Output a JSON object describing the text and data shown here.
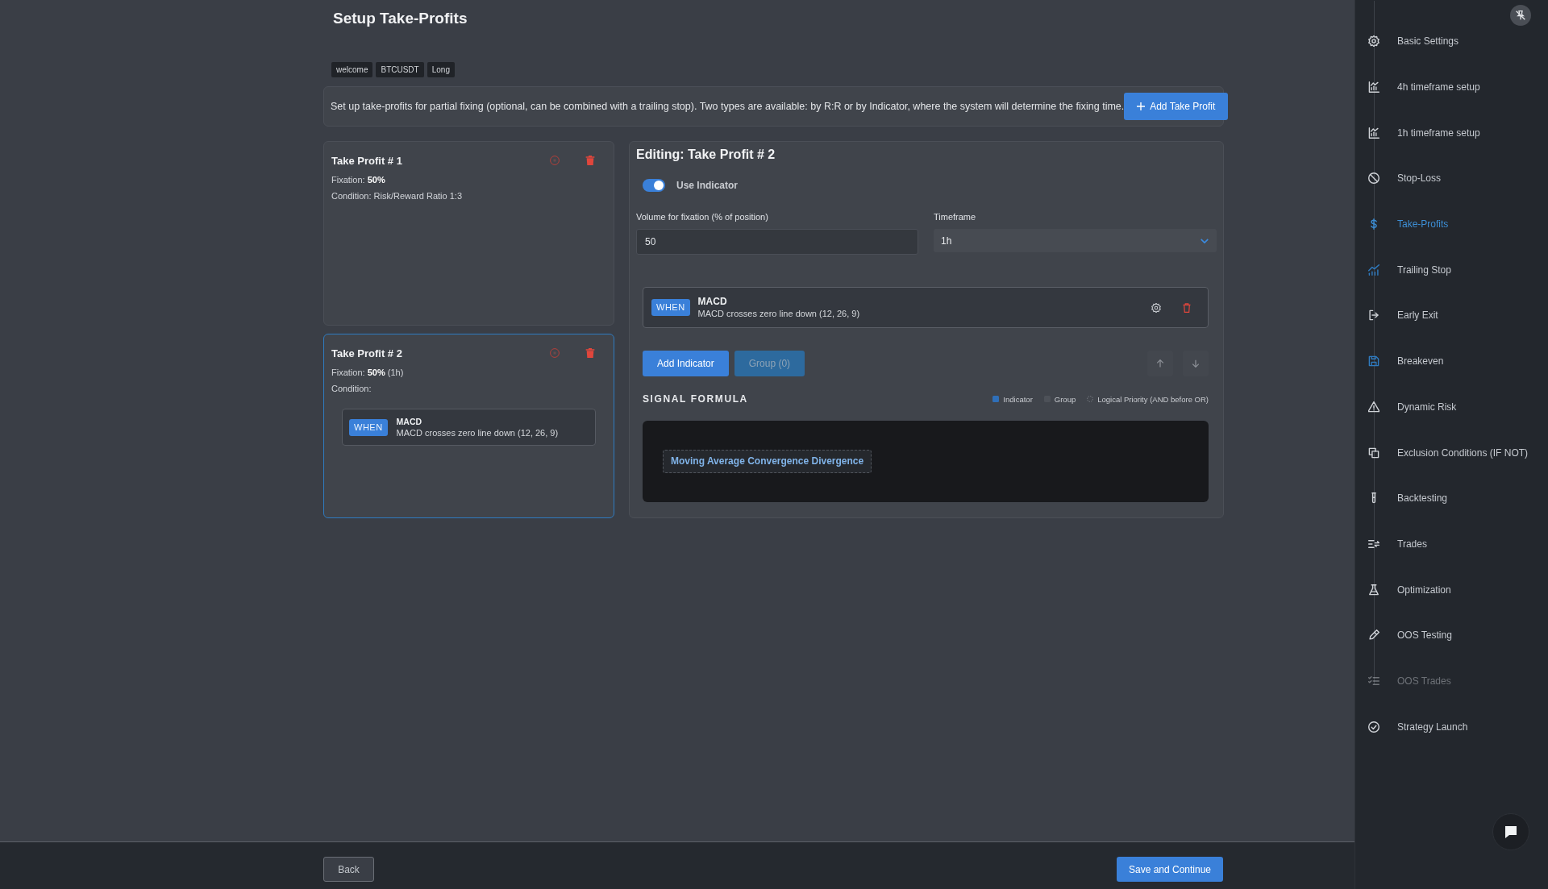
{
  "page": {
    "title": "Setup Take-Profits",
    "tags": [
      "welcome",
      "BTCUSDT",
      "Long"
    ]
  },
  "info_bar": {
    "text": "Set up take-profits for partial fixing (optional, can be combined with a trailing stop). Two types are available: by R:R or by Indicator, where the system will determine the fixing time.",
    "button": "Add Take Profit"
  },
  "take_profits": [
    {
      "title": "Take Profit # 1",
      "fixation": "Fixation: **50%**",
      "condition": "Condition: Risk/Reward Ratio 1:3",
      "selected": false
    },
    {
      "title": "Take Profit # 2",
      "fixation": "Fixation: **50%** (1h)",
      "condition": "Condition:",
      "selected": true,
      "rules": [
        {
          "badge": "WHEN",
          "name": "MACD",
          "description": "MACD crosses zero line down (12, 26, 9)"
        }
      ]
    }
  ],
  "editor": {
    "title": "Editing: Take Profit # 2",
    "toggle": {
      "label": "Use Indicator",
      "on": true
    },
    "volume": {
      "label": "Volume for fixation (% of position)",
      "value": "50"
    },
    "timeframe": {
      "label": "Timeframe",
      "value": "1h"
    },
    "rules": [
      {
        "badge": "WHEN",
        "name": "MACD",
        "description": "MACD crosses zero line down (12, 26, 9)"
      }
    ],
    "buttons": [
      {
        "label": "Add Indicator",
        "disabled": false
      },
      {
        "label": "Group (0)",
        "disabled": true
      }
    ]
  },
  "formula": {
    "title": "SIGNAL FORMULA",
    "legend": [
      {
        "label": "Indicator",
        "kind": "square",
        "color": "#2f6fb8"
      },
      {
        "label": "Group",
        "kind": "square",
        "color": "#4d5158"
      },
      {
        "label": "Logical Priority (AND before OR)",
        "kind": "ring"
      }
    ],
    "chips": [
      "Moving Average Convergence Divergence"
    ]
  },
  "footer": {
    "back": "Back",
    "next": "Save and Continue"
  },
  "sidebar": {
    "items": [
      {
        "label": "Basic Settings",
        "selected": false,
        "disabled": false,
        "icon_accent": false
      },
      {
        "label": "4h timeframe setup",
        "selected": false,
        "disabled": false,
        "icon_accent": false
      },
      {
        "label": "1h timeframe setup",
        "selected": false,
        "disabled": false,
        "icon_accent": false
      },
      {
        "label": "Stop-Loss",
        "selected": false,
        "disabled": false,
        "icon_accent": false
      },
      {
        "label": "Take-Profits",
        "selected": true,
        "disabled": false,
        "icon_accent": false
      },
      {
        "label": "Trailing Stop",
        "selected": false,
        "disabled": false,
        "icon_accent": true
      },
      {
        "label": "Early Exit",
        "selected": false,
        "disabled": false,
        "icon_accent": false
      },
      {
        "label": "Breakeven",
        "selected": false,
        "disabled": false,
        "icon_accent": true
      },
      {
        "label": "Dynamic Risk",
        "selected": false,
        "disabled": false,
        "icon_accent": false
      },
      {
        "label": "Exclusion Conditions (IF NOT)",
        "selected": false,
        "disabled": false,
        "icon_accent": false
      },
      {
        "label": "Backtesting",
        "selected": false,
        "disabled": false,
        "icon_accent": false
      },
      {
        "label": "Trades",
        "selected": false,
        "disabled": false,
        "icon_accent": false
      },
      {
        "label": "Optimization",
        "selected": false,
        "disabled": false,
        "icon_accent": false
      },
      {
        "label": "OOS Testing",
        "selected": false,
        "disabled": false,
        "icon_accent": false
      },
      {
        "label": "OOS Trades",
        "selected": false,
        "disabled": true,
        "icon_accent": false
      },
      {
        "label": "Strategy Launch",
        "selected": false,
        "disabled": false,
        "icon_accent": false
      }
    ]
  }
}
